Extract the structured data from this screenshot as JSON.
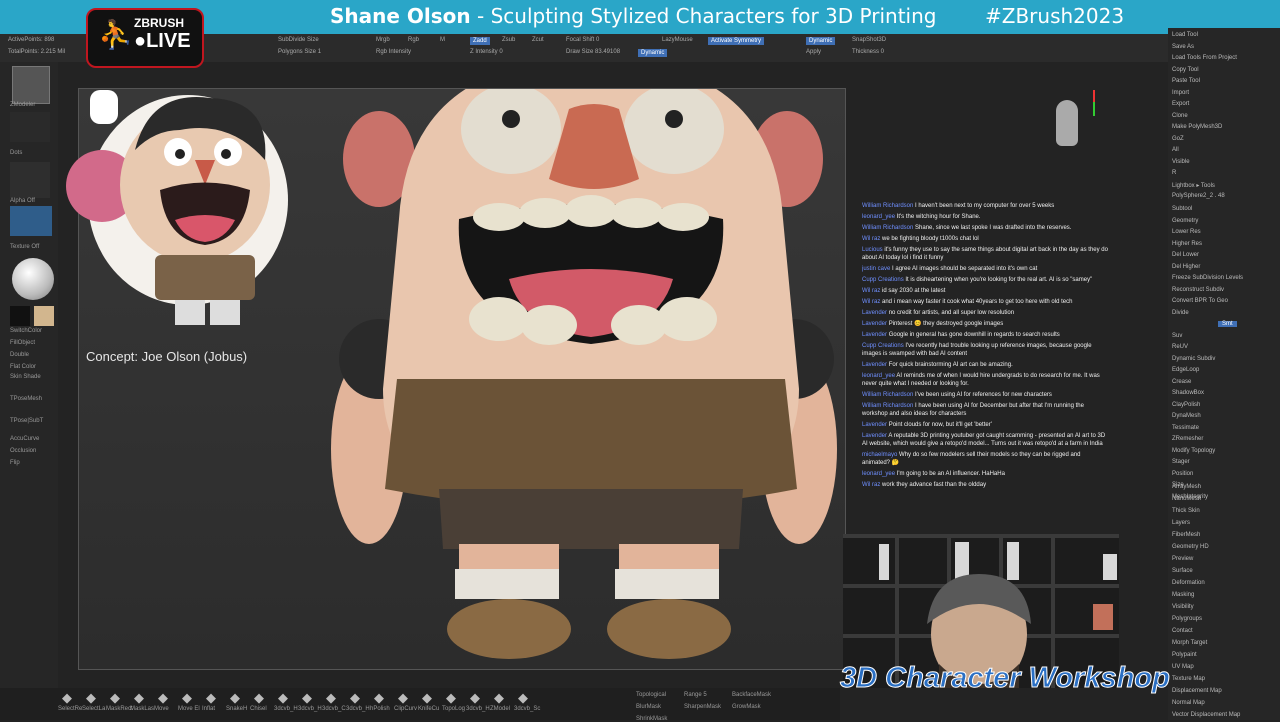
{
  "banner": {
    "name": "Shane Olson",
    "separator": " - ",
    "subtitle": "Sculpting Stylized Characters for 3D Printing",
    "hashtag": "#ZBrush2023"
  },
  "logo": {
    "line1": "ZBRUSH",
    "line2": "●LIVE"
  },
  "stats": {
    "active_points": "ActivePoints: 898",
    "total_points": "TotalPoints: 2.215 Mil"
  },
  "topbar": {
    "items": [
      "SubDivide Size",
      "Polygons Size 1",
      "Mrgb",
      "Rgb",
      "M",
      "Zadd",
      "Zsub",
      "Zcut",
      "Focal Shift 0",
      "Draw Size 83.49108",
      "Dynamic",
      "LazyMouse",
      "Activate Symmetry",
      "Dynamic",
      "SnapShot3D",
      "Thickness 0",
      "Z Intensity 0",
      "Apply",
      "Rgb Intensity"
    ]
  },
  "leftbar": {
    "items": [
      "ZModeler",
      "Dots",
      "Alpha Off",
      "Texture Off",
      "SwitchColor",
      "FillObject",
      "Double",
      "Flat Color",
      "Skin Shade",
      "TPoseMesh",
      "TPose|SubT",
      "AccuCurve",
      "Occlusion",
      "Flip"
    ]
  },
  "rightpanel": {
    "top_items": [
      "Load Tool",
      "Save As",
      "Load Tools From Project",
      "Copy Tool",
      "Paste Tool",
      "Import",
      "Export",
      "Clone",
      "Make PolyMesh3D",
      "GoZ",
      "All",
      "Visible",
      "R",
      "Lightbox ▸ Tools",
      "PolySphere2_2 . 48"
    ],
    "subtool_items": [
      "Subtool",
      "Geometry",
      "Lower Res",
      "Higher Res",
      "Del Lower",
      "Del Higher",
      "Freeze SubDivision Levels",
      "Reconstruct Subdiv",
      "Convert BPR To Geo",
      "Divide",
      "Smt",
      "Suv",
      "ReUV",
      "Dynamic Subdiv",
      "EdgeLoop",
      "Crease",
      "ShadowBox",
      "ClayPolish",
      "DynaMesh",
      "Tessimate",
      "ZRemesher",
      "Modify Topology",
      "Stager",
      "Position",
      "Size",
      "MeshIntegrity"
    ],
    "bottom_items": [
      "ArrayMesh",
      "NanoMesh",
      "Thick Skin",
      "Layers",
      "FiberMesh",
      "Geometry HD",
      "Preview",
      "Surface",
      "Deformation",
      "Masking",
      "Visibility",
      "Polygroups",
      "Contact",
      "Morph Target",
      "Polypaint",
      "UV Map",
      "Texture Map",
      "Displacement Map",
      "Normal Map",
      "Vector Displacement Map"
    ]
  },
  "concept_label": "Concept: Joe Olson (Jobus)",
  "chat": [
    {
      "user": "William Richardson",
      "text": "I haven't been next to my computer for over 5 weeks"
    },
    {
      "user": "leonard_yee",
      "text": "It's the witching hour for Shane."
    },
    {
      "user": "William Richardson",
      "text": "Shane, since we last spoke I was drafted into the reserves."
    },
    {
      "user": "Wil raz",
      "text": "we be fighting bloody t1000s chat lol"
    },
    {
      "user": "Lucious",
      "text": "it's funny they use to say the same things about digital art back in the day as they do about AI today lol i find it funny"
    },
    {
      "user": "justin cave",
      "text": "I agree AI images should be separated into it's own cat"
    },
    {
      "user": "Cupp Creations",
      "text": "It is disheartening when you're looking for the real art. AI is so \"samey\""
    },
    {
      "user": "Wil raz",
      "text": "id say 2030 at the latest"
    },
    {
      "user": "Wil raz",
      "text": "and i mean way faster it cook what 40years to get too here with old tech"
    },
    {
      "user": "Lavender",
      "text": "no credit for artists, and all super low resolution"
    },
    {
      "user": "Lavender",
      "text": "Pinterest 😊 they destroyed google images"
    },
    {
      "user": "Lavender",
      "text": "Google in general has gone downhill in regards to search results"
    },
    {
      "user": "Cupp Creations",
      "text": "I've recently had trouble looking up reference images, because google images is swamped with bad AI content"
    },
    {
      "user": "Lavender",
      "text": "For quick brainstorming AI art can be amazing."
    },
    {
      "user": "leonard_yee",
      "text": "AI reminds me of when I would hire undergrads to do research for me. It was never quite what I needed or looking for."
    },
    {
      "user": "William Richardson",
      "text": "I've been using AI for references for new characters"
    },
    {
      "user": "William Richardson",
      "text": "I have been using AI for December but after that I'm running the workshop and also ideas for characters"
    },
    {
      "user": "Lavender",
      "text": "Point clouds for now, but it'll get 'better'"
    },
    {
      "user": "Lavender",
      "text": "A reputable 3D printing youtuber got caught scamming - presented an AI art to 3D AI website, which would give a retopo'd model... Turns out it was retopo'd at a farm in India"
    },
    {
      "user": "michaelmayo",
      "text": "Why do so few modelers sell their models so they can be rigged and animated? 🤔"
    },
    {
      "user": "leonard_yee",
      "text": "I'm going to be an AI influencer. HaHaHa"
    },
    {
      "user": "Wil raz",
      "text": "work they advance fast than the oldday"
    }
  ],
  "bottombar": {
    "items": [
      "SelectRe",
      "SelectLa",
      "MaskRect",
      "MaskLas",
      "Move",
      "Move El",
      "Inflat",
      "SnakeH",
      "Chisel",
      "3dcvb_H",
      "3dcvb_H",
      "3dcvb_C",
      "3dcvb_H",
      "hPolish",
      "ClipCurv",
      "KnifeCu",
      "TopoLog",
      "3dcvb_H",
      "ZModel",
      "3dcvb_Sc",
      "Topological",
      "Range 5",
      "BackfaceMask",
      "BlurMask",
      "SharpenMask",
      "GrowMask",
      "ShrinkMask"
    ]
  },
  "workshop_logo": "3D Character Workshop",
  "colors": {
    "banner": "#2aa6c8",
    "active_button": "#3f6fb5",
    "chat_user": "#6f8fff",
    "workshop_blue": "#2a6fc4",
    "live_red": "#c0161f"
  }
}
